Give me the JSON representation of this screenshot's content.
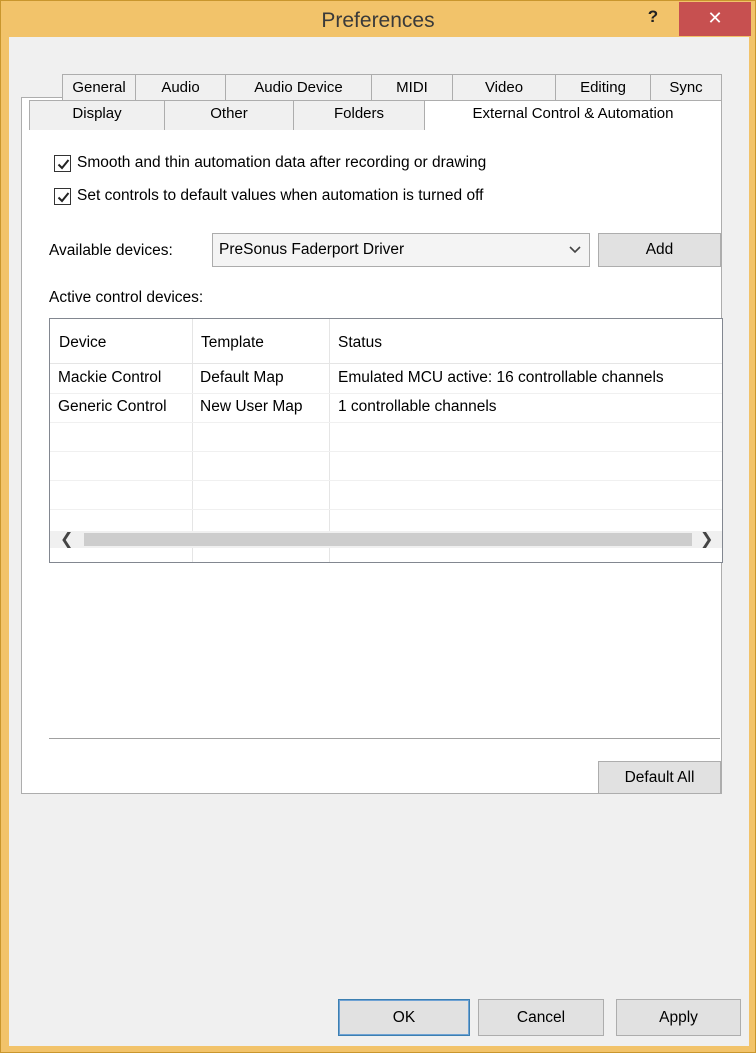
{
  "window": {
    "title": "Preferences",
    "help_label": "?",
    "close_label": "✕"
  },
  "tabs": {
    "row1": [
      "General",
      "Audio",
      "Audio Device",
      "MIDI",
      "Video",
      "Editing",
      "Sync"
    ],
    "row2": [
      "Display",
      "Other",
      "Folders"
    ],
    "active": "External Control & Automation"
  },
  "options": {
    "smooth_label": "Smooth and thin automation data after recording or drawing",
    "smooth_checked": true,
    "defaults_label": "Set controls to default values when automation is turned off",
    "defaults_checked": true
  },
  "available": {
    "label": "Available devices:",
    "selected": "PreSonus Faderport Driver",
    "add_label": "Add"
  },
  "active_devices": {
    "label": "Active control devices:",
    "columns": [
      "Device",
      "Template",
      "Status"
    ],
    "rows": [
      [
        "Mackie Control",
        "Default Map",
        "Emulated MCU active: 16 controllable channels"
      ],
      [
        "Generic Control",
        "New User Map",
        "1 controllable channels"
      ]
    ]
  },
  "buttons": {
    "default_all": "Default All",
    "ok": "OK",
    "cancel": "Cancel",
    "apply": "Apply"
  },
  "colors": {
    "title_bar": "#f2c36a",
    "close_button": "#c75050",
    "default_button_border": "#3c7fb1"
  },
  "icons": {
    "checkbox": "checkmark-icon",
    "dropdown": "chevron-down-icon",
    "scroll_left": "chevron-left-icon",
    "scroll_right": "chevron-right-icon"
  }
}
